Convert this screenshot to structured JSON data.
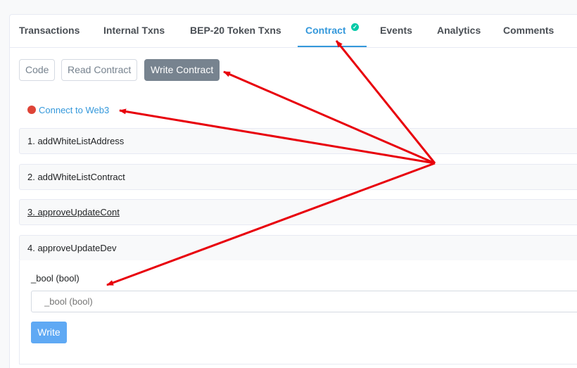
{
  "tabs": [
    {
      "label": "Transactions"
    },
    {
      "label": "Internal Txns"
    },
    {
      "label": "BEP-20 Token Txns"
    },
    {
      "label": "Contract"
    },
    {
      "label": "Events"
    },
    {
      "label": "Analytics"
    },
    {
      "label": "Comments"
    }
  ],
  "active_tab": "Contract",
  "subtabs": {
    "code": "Code",
    "read": "Read Contract",
    "write": "Write Contract"
  },
  "connect_label": "Connect to Web3",
  "functions": [
    {
      "label": "1. addWhiteListAddress"
    },
    {
      "label": "2. addWhiteListContract"
    },
    {
      "label": "3. approveUpdateCont"
    },
    {
      "label": "4. approveUpdateDev"
    }
  ],
  "open_function": {
    "param_label": "_bool (bool)",
    "input_placeholder": "_bool (bool)",
    "write_label": "Write"
  },
  "colors": {
    "accent": "#3498db",
    "annotation": "#e8000b",
    "write_button": "#5fa9f4",
    "disconnected_dot": "#de4437"
  }
}
